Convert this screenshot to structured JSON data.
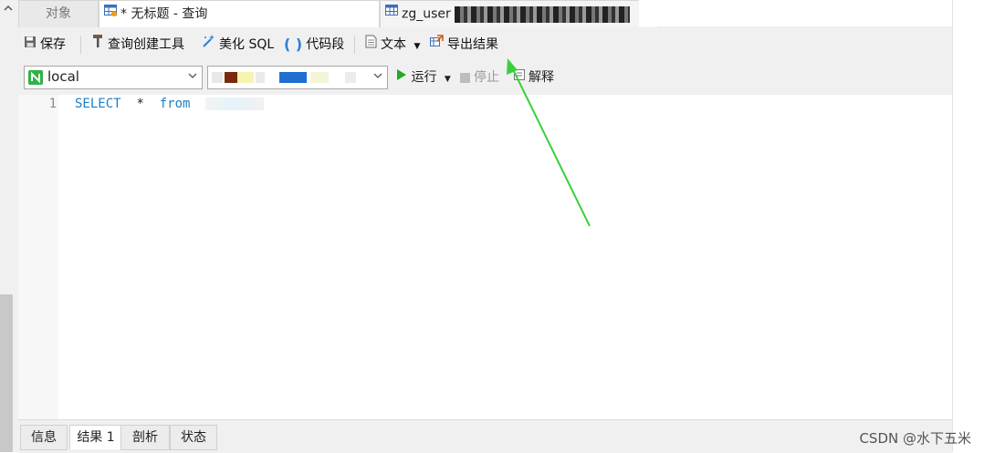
{
  "tabs": {
    "objects": "对象",
    "query": "* 无标题 - 查询",
    "table_prefix": "zg_user"
  },
  "toolbar": {
    "save": "保存",
    "query_builder": "查询创建工具",
    "beautify_sql": "美化 SQL",
    "code_snippet": "代码段",
    "text": "文本",
    "export_results": "导出结果"
  },
  "connection": {
    "selected": "local"
  },
  "run": {
    "run": "运行",
    "stop": "停止",
    "explain": "解释"
  },
  "editor": {
    "line_number": "1",
    "kw_select": "SELECT",
    "star": "*",
    "kw_from": "from"
  },
  "bottom_tabs": {
    "info": "信息",
    "result1": "结果 1",
    "profile": "剖析",
    "status": "状态"
  },
  "watermark": "CSDN @水下五米",
  "colors": {
    "keyword": "#1d7fc4",
    "arrow": "#3ccf3c",
    "run_green": "#22aa22"
  },
  "icons": {
    "collapse": "chevron-up-icon",
    "query_tab": "query-table-icon",
    "table_tab": "table-grid-icon",
    "save": "floppy-disk-icon",
    "query_builder": "hammer-icon",
    "beautify": "magic-wand-icon",
    "code_snippet": "parentheses-icon",
    "text": "document-icon",
    "export": "export-icon",
    "connection": "navicat-connection-icon",
    "run": "play-icon",
    "stop": "stop-square-icon",
    "explain": "explain-icon"
  }
}
